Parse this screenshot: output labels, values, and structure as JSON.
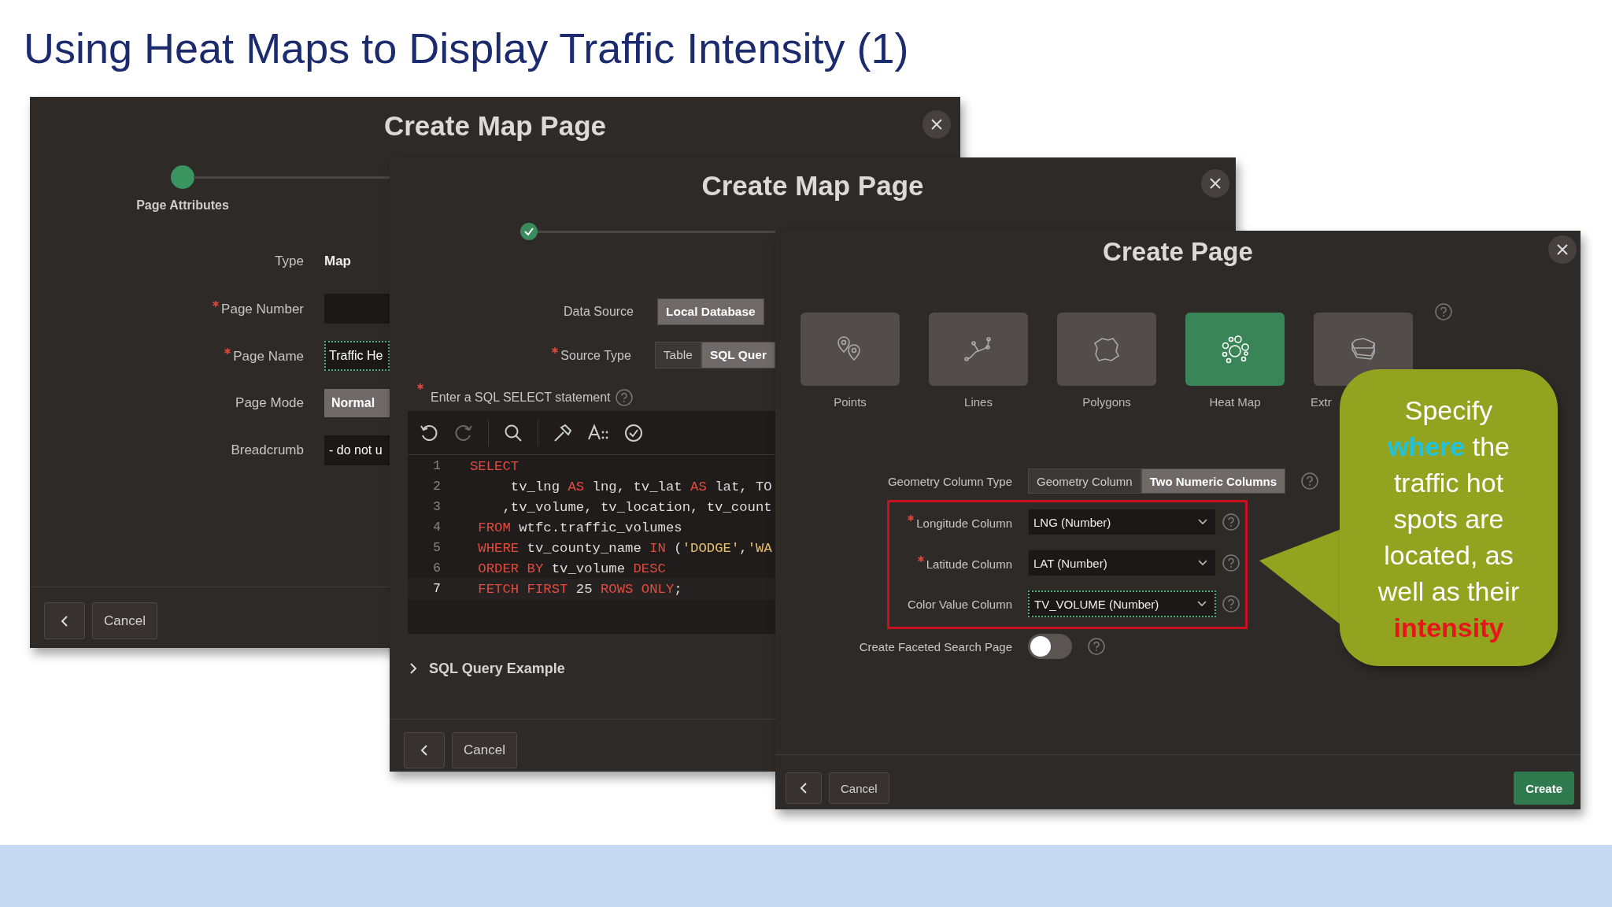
{
  "title": "Using Heat Maps to Display Traffic Intensity (1)",
  "attributes_dialog": {
    "title": "Create Map Page",
    "step_label": "Page Attributes",
    "fields": [
      {
        "label": "Type",
        "kind": "text",
        "value": "Map",
        "required": false
      },
      {
        "label": "Page Number",
        "kind": "input",
        "required": true,
        "focused": false
      },
      {
        "label": "Page Name",
        "kind": "input",
        "value": "Traffic He",
        "required": true,
        "focused": true
      },
      {
        "label": "Page Mode",
        "kind": "segment",
        "value": "Normal",
        "required": false,
        "selected": true
      },
      {
        "label": "Breadcrumb",
        "kind": "input",
        "value": "- do not u",
        "required": false,
        "focused": false
      }
    ],
    "cancel_button": "Cancel"
  },
  "source_dialog": {
    "title": "Create Map Page",
    "fields": [
      {
        "label": "Data Source",
        "required": false,
        "options": [
          {
            "label": "Local Database",
            "selected": true
          }
        ]
      },
      {
        "label": "Source Type",
        "required": true,
        "options": [
          {
            "label": "Table",
            "selected": false
          },
          {
            "label": "SQL Quer",
            "selected": true
          }
        ]
      }
    ],
    "sql_label": "Enter a SQL SELECT statement",
    "sql_required": true,
    "code_lines": [
      {
        "number": "1",
        "current": false,
        "tokens": [
          {
            "text": "SELECT",
            "kind": "keyword"
          }
        ]
      },
      {
        "number": "2",
        "current": false,
        "tokens": [
          {
            "text": "     tv_lng ",
            "kind": "plain"
          },
          {
            "text": "AS",
            "kind": "keyword"
          },
          {
            "text": " lng, tv_lat ",
            "kind": "plain"
          },
          {
            "text": "AS",
            "kind": "keyword"
          },
          {
            "text": " lat, TO",
            "kind": "plain"
          }
        ]
      },
      {
        "number": "3",
        "current": false,
        "tokens": [
          {
            "text": "    ,tv_volume, tv_location, tv_count",
            "kind": "plain"
          }
        ]
      },
      {
        "number": "4",
        "current": false,
        "tokens": [
          {
            "text": " FROM",
            "kind": "keyword"
          },
          {
            "text": " wtfc.traffic_volumes",
            "kind": "plain"
          }
        ]
      },
      {
        "number": "5",
        "current": false,
        "tokens": [
          {
            "text": " WHERE",
            "kind": "keyword"
          },
          {
            "text": " tv_county_name ",
            "kind": "plain"
          },
          {
            "text": "IN",
            "kind": "keyword"
          },
          {
            "text": " (",
            "kind": "plain"
          },
          {
            "text": "'DODGE'",
            "kind": "string"
          },
          {
            "text": ",",
            "kind": "plain"
          },
          {
            "text": "'WA",
            "kind": "string"
          }
        ]
      },
      {
        "number": "6",
        "current": false,
        "tokens": [
          {
            "text": " ORDER BY",
            "kind": "keyword"
          },
          {
            "text": " tv_volume ",
            "kind": "plain"
          },
          {
            "text": "DESC",
            "kind": "keyword"
          }
        ]
      },
      {
        "number": "7",
        "current": true,
        "tokens": [
          {
            "text": " FETCH FIRST",
            "kind": "keyword"
          },
          {
            "text": " 25 ",
            "kind": "plain"
          },
          {
            "text": "ROWS ONLY",
            "kind": "keyword"
          },
          {
            "text": ";",
            "kind": "plain"
          }
        ]
      }
    ],
    "expander": {
      "label": "SQL Query Example",
      "expanded": false
    },
    "cancel_button": "Cancel"
  },
  "create_page_dialog": {
    "title": "Create Page",
    "tiles": [
      {
        "label": "Points",
        "kind": "points",
        "selected": false
      },
      {
        "label": "Lines",
        "kind": "lines",
        "selected": false
      },
      {
        "label": "Polygons",
        "kind": "polygons",
        "selected": false
      },
      {
        "label": "Heat Map",
        "kind": "heatmap",
        "selected": true
      },
      {
        "label": "Extr",
        "kind": "extrusion",
        "selected": false
      }
    ],
    "geometry_type": {
      "label": "Geometry Column Type",
      "options": [
        {
          "label": "Geometry Column",
          "selected": false
        },
        {
          "label": "Two Numeric Columns",
          "selected": true
        }
      ]
    },
    "columns": [
      {
        "label": "Longitude Column",
        "value": "LNG (Number)",
        "required": true,
        "focused": false
      },
      {
        "label": "Latitude Column",
        "value": "LAT (Number)",
        "required": true,
        "focused": false
      },
      {
        "label": "Color Value Column",
        "value": "TV_VOLUME (Number)",
        "required": false,
        "focused": true
      }
    ],
    "faceted": {
      "label": "Create Faceted Search Page",
      "on": false
    },
    "cancel_button": "Cancel",
    "create_button": "Create"
  },
  "callout": {
    "parts": [
      {
        "text": "Specify ",
        "emphasis": false
      },
      {
        "text": "where",
        "emphasis": true,
        "color": "#1fc3e0"
      },
      {
        "text": " the traffic hot spots are located, as well as their ",
        "emphasis": false
      },
      {
        "text": "intensity",
        "emphasis": true,
        "color": "#e8141c"
      }
    ]
  }
}
